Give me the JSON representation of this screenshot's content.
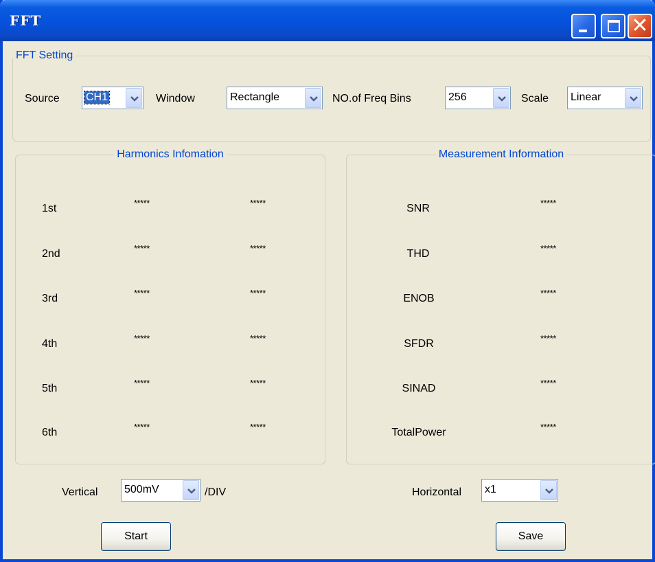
{
  "window": {
    "title": "FFT"
  },
  "fft_setting": {
    "legend": "FFT Setting",
    "source": {
      "label": "Source",
      "value": "CH1"
    },
    "window": {
      "label": "Window",
      "value": "Rectangle"
    },
    "bins": {
      "label": "NO.of Freq Bins",
      "value": "256"
    },
    "scale": {
      "label": "Scale",
      "value": "Linear"
    }
  },
  "harmonics": {
    "legend": "Harmonics Infomation",
    "rows": [
      {
        "label": "1st",
        "v1": "*****",
        "v2": "*****"
      },
      {
        "label": "2nd",
        "v1": "*****",
        "v2": "*****"
      },
      {
        "label": "3rd",
        "v1": "*****",
        "v2": "*****"
      },
      {
        "label": "4th",
        "v1": "*****",
        "v2": "*****"
      },
      {
        "label": "5th",
        "v1": "*****",
        "v2": "*****"
      },
      {
        "label": "6th",
        "v1": "*****",
        "v2": "*****"
      }
    ]
  },
  "measurement": {
    "legend": "Measurement Information",
    "rows": [
      {
        "label": "SNR",
        "value": "*****"
      },
      {
        "label": "THD",
        "value": "*****"
      },
      {
        "label": "ENOB",
        "value": "*****"
      },
      {
        "label": "SFDR",
        "value": "*****"
      },
      {
        "label": "SINAD",
        "value": "*****"
      },
      {
        "label": "TotalPower",
        "value": "*****"
      }
    ]
  },
  "vertical": {
    "label": "Vertical",
    "value": "500mV",
    "unit": "/DIV"
  },
  "horizontal": {
    "label": "Horizontal",
    "value": "x1"
  },
  "buttons": {
    "start": "Start",
    "save": "Save"
  },
  "colors": {
    "accent": "#0046d5",
    "titlebar": "#0551dc",
    "face": "#ece9d8"
  }
}
